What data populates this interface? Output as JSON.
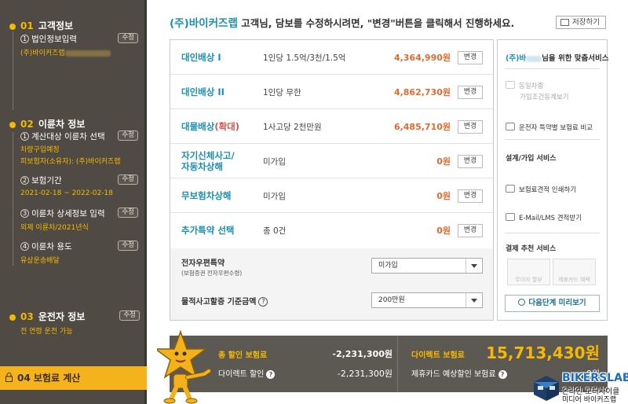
{
  "sidebar": {
    "sec1": {
      "num": "01",
      "title": "고객정보"
    },
    "sec1_items": [
      {
        "circ": "1",
        "label": "법인정보입력",
        "sub": "(주)바이커즈랩",
        "edit": "수정"
      }
    ],
    "sec2": {
      "num": "02",
      "title": "이륜차 정보"
    },
    "sec2_items": [
      {
        "circ": "1",
        "label": "계산대상 이륜차 선택",
        "sub1": "차량구입예정",
        "sub2": "피보험자(소유자): (주)바이커즈랩",
        "edit": "수정"
      },
      {
        "circ": "2",
        "label": "보험기간",
        "sub1": "2021-02-18 ~ 2022-02-18",
        "edit": "수정"
      },
      {
        "circ": "3",
        "label": "이륜차 상세정보 입력",
        "sub1": "외제 이륜차/2021년식",
        "edit": "수정"
      },
      {
        "circ": "4",
        "label": "이륜차 용도",
        "sub1": "유상운송배달",
        "edit": "수정"
      }
    ],
    "sec3": {
      "num": "03",
      "title": "운전자 정보",
      "sub": "전 연령 운전 가능",
      "edit": "수정"
    },
    "sec4": {
      "num": "04",
      "title": "보험료 계산"
    }
  },
  "header": {
    "brand": "(주)바이커즈랩",
    "message": " 고객님, 담보를 수정하시려면, \"변경\"버튼을 클릭해서 진행하세요.",
    "save": "저장하기"
  },
  "coverages": [
    {
      "name": "대인배상 I",
      "desc": "1인당 1.5억/3천/1.5억",
      "price": "4,364,990원",
      "btn": "변경"
    },
    {
      "name": "대인배상 II",
      "desc": "1인당 무한",
      "price": "4,862,730원",
      "btn": "변경"
    },
    {
      "name": "대물배상",
      "name_hl": "(확대)",
      "desc": "1사고당 2천만원",
      "price": "6,485,710원",
      "btn": "변경"
    },
    {
      "name_line1": "자기신체사고/",
      "name_line2": "자동차상해",
      "desc": "미가입",
      "price": "0원",
      "btn": "변경"
    },
    {
      "name": "무보험차상해",
      "desc": "미가입",
      "price": "0원",
      "btn": "변경"
    },
    {
      "name": "추가특약 선택",
      "desc": "총 0건",
      "price": "0원",
      "btn": "변경"
    }
  ],
  "options": {
    "epost_label": "전자우편특약",
    "epost_sub": "(보험증권 전자우편수령)",
    "epost_value": "미가입",
    "property_label": "물적사고할증 기준금액",
    "property_q": "?",
    "property_value": "200만원"
  },
  "right_panel": {
    "brand": "(주)바",
    "head_rest": "님을 위한 맞춤서비스",
    "item1_line1": "동일차종",
    "item1_line2": "가입조건동계보기",
    "item2": "운전자 특약별 보험료 비교",
    "sec_design": "설계/가입 서비스",
    "item3": "보험료견적 인쇄하기",
    "item4": "E-Mail/LMS 견적받기",
    "sec_payment": "결제 추천 서비스",
    "mini1": "무이자 할부",
    "mini2": "제휴카드 혜택",
    "next": "다음단계 미리보기"
  },
  "summary": {
    "total_discount_label": "총 할인 보험료",
    "total_discount_value": "-2,231,300원",
    "direct_discount_label": "다이렉트 할인",
    "direct_discount_value": "-2,231,300원",
    "direct_premium_label": "다이렉트 보험료",
    "direct_premium_value": "15,713,430원",
    "card_label": "제휴카드 예상할인 보험료",
    "card_value": "0원",
    "q": "?"
  },
  "watermark": {
    "lab": "BIKERSLAB",
    "line1": "온라인 모터사이클",
    "line2": "미디어 바이커즈랩"
  },
  "colors": {
    "sidebar_bg": "#4f4a43",
    "accent_yellow": "#f6b800",
    "brand_blue": "#1b8fb3",
    "price_orange": "#e36a2e",
    "summary_bg": "#5c5852"
  }
}
